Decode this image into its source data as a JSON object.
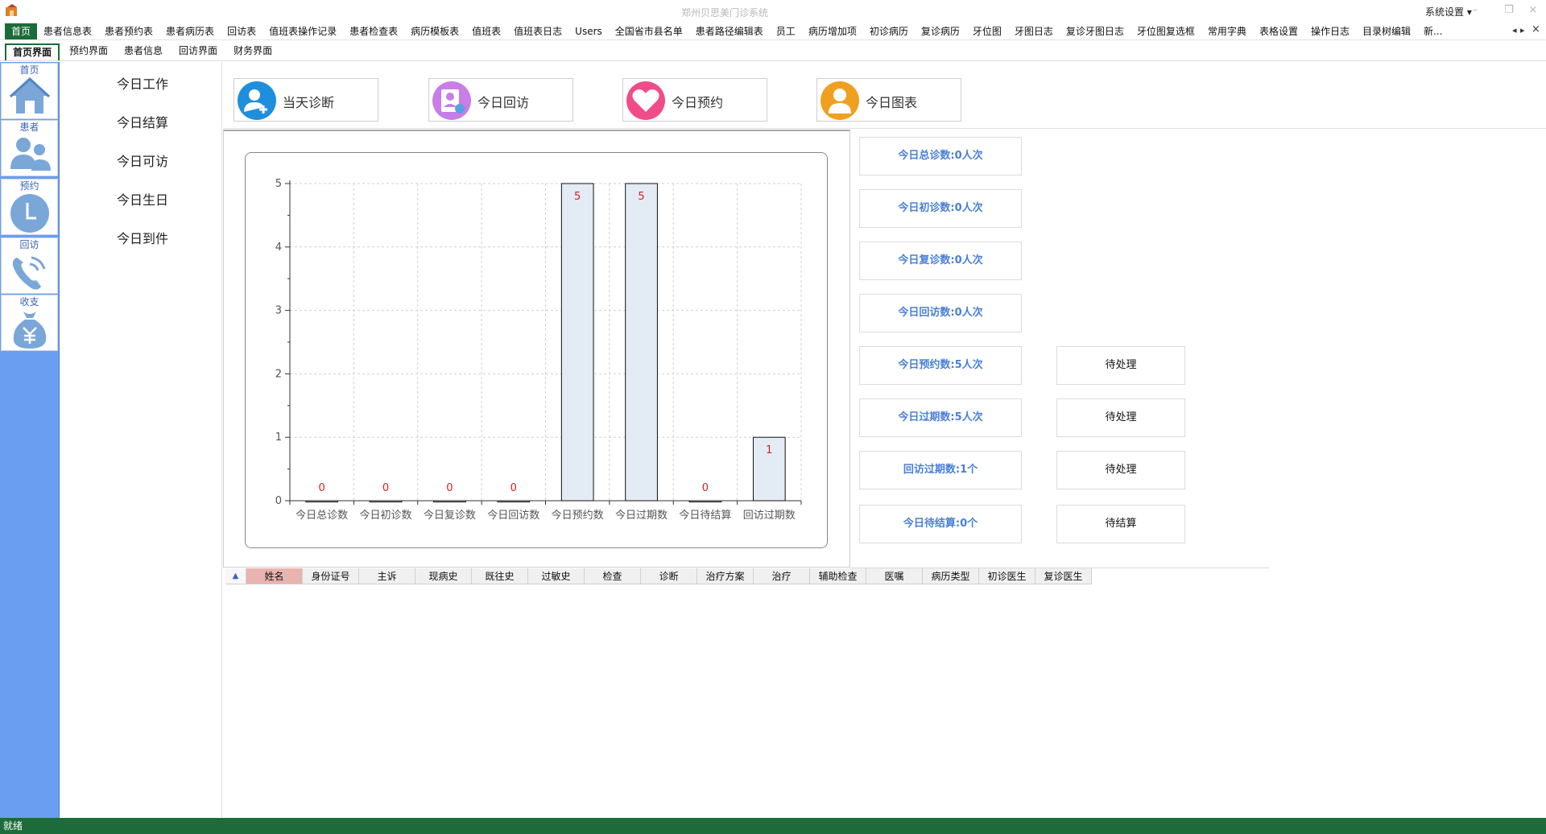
{
  "window": {
    "title": "郑州贝思美门诊系统",
    "system_settings": "系统设置 ▾",
    "minimize": "–",
    "restore": "❐",
    "close": "×"
  },
  "menu": {
    "items": [
      "首页",
      "患者信息表",
      "患者预约表",
      "患者病历表",
      "回访表",
      "值班表操作记录",
      "患者检查表",
      "病历模板表",
      "值班表",
      "值班表日志",
      "Users",
      "全国省市县名单",
      "患者路径编辑表",
      "员工",
      "病历增加项",
      "初诊病历",
      "复诊病历",
      "牙位图",
      "牙图日志",
      "复诊牙图日志",
      "牙位图复选框",
      "常用字典",
      "表格设置",
      "操作日志",
      "目录树编辑",
      "新..."
    ],
    "scroll_left": "◂",
    "scroll_right": "▸",
    "close": "×"
  },
  "subtabs": [
    "首页界面",
    "预约界面",
    "患者信息",
    "回访界面",
    "财务界面"
  ],
  "leftnav": {
    "items": [
      {
        "label": "首页",
        "icon": "home-icon"
      },
      {
        "label": "患者",
        "icon": "users-icon"
      },
      {
        "label": "预约",
        "icon": "clock-icon"
      },
      {
        "label": "回访",
        "icon": "phone-icon"
      },
      {
        "label": "收支",
        "icon": "money-bag-icon"
      }
    ]
  },
  "today": {
    "items": [
      "今日工作",
      "今日结算",
      "今日可访",
      "今日生日",
      "今日到件"
    ]
  },
  "quick": {
    "items": [
      {
        "label": "当天诊断",
        "color": "#1e8fdc",
        "icon": "add-user-icon"
      },
      {
        "label": "今日回访",
        "color": "#c77ee6",
        "icon": "doctor-icon"
      },
      {
        "label": "今日预约",
        "color": "#f04c8a",
        "icon": "heart-icon"
      },
      {
        "label": "今日图表",
        "color": "#f0a020",
        "icon": "person-icon"
      }
    ]
  },
  "chart_data": {
    "type": "bar",
    "categories": [
      "今日总诊数",
      "今日初诊数",
      "今日复诊数",
      "今日回访数",
      "今日预约数",
      "今日过期数",
      "今日待结算",
      "回访过期数"
    ],
    "values": [
      0,
      0,
      0,
      0,
      5,
      5,
      0,
      1
    ],
    "ylim": [
      0,
      5
    ],
    "yticks": [
      0,
      1,
      2,
      3,
      4,
      5
    ],
    "grid": true,
    "bar_color": "#e3ebf5",
    "label_color": "#d22020"
  },
  "stats": {
    "items": [
      {
        "label": "今日总诊数:0人次",
        "action": ""
      },
      {
        "label": "今日初诊数:0人次",
        "action": ""
      },
      {
        "label": "今日复诊数:0人次",
        "action": ""
      },
      {
        "label": "今日回访数:0人次",
        "action": ""
      },
      {
        "label": "今日预约数:5人次",
        "action": "待处理"
      },
      {
        "label": "今日过期数:5人次",
        "action": "待处理"
      },
      {
        "label": "回访过期数:1个",
        "action": "待处理"
      },
      {
        "label": "今日待结算:0个",
        "action": "待结算"
      }
    ]
  },
  "grid": {
    "corner": "▲",
    "columns": [
      "姓名",
      "身份证号",
      "主诉",
      "现病史",
      "既往史",
      "过敏史",
      "检查",
      "诊断",
      "治疗方案",
      "治疗",
      "辅助检查",
      "医嘱",
      "病历类型",
      "初诊医生",
      "复诊医生"
    ]
  },
  "status": {
    "text": "就绪"
  }
}
